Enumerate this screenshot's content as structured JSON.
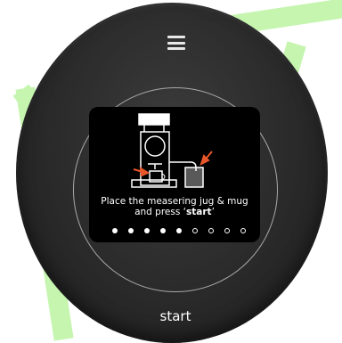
{
  "header": {
    "menu_icon": "hamburger-menu-icon"
  },
  "instruction": {
    "prefix": "Place the measering jug & mug",
    "line2_prefix": "and press ‘",
    "keyword": "start",
    "line2_suffix": "’"
  },
  "pager": {
    "total": 9,
    "current": 5
  },
  "actions": {
    "start_label": "start"
  },
  "colors": {
    "watermark": "#b9f3a0",
    "bezel": "#2a2a2a",
    "screen": "#000000",
    "arrow": "#e8562a",
    "text": "#ffffff"
  },
  "illustration": {
    "icons": [
      "coffee-machine-icon",
      "measuring-jug-icon",
      "mug-icon",
      "arrow-icon"
    ]
  }
}
